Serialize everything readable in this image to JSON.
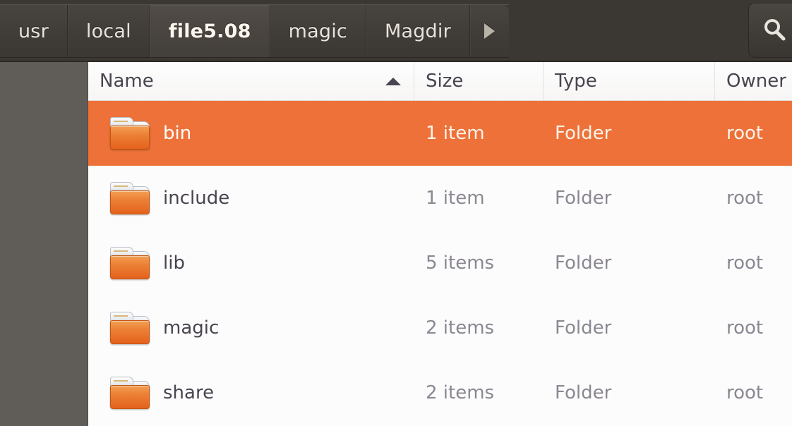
{
  "window": {
    "title": "file5.08",
    "accent_color": "#ed7138",
    "toolbar_bg": "#3b3834",
    "sidebar_bg": "#605c57"
  },
  "pathbar": {
    "crumbs": [
      {
        "label": "usr",
        "active": false
      },
      {
        "label": "local",
        "active": false
      },
      {
        "label": "file5.08",
        "active": true
      },
      {
        "label": "magic",
        "active": false
      },
      {
        "label": "Magdir",
        "active": false
      }
    ],
    "overflow_icon": "chevron-right-icon"
  },
  "toolbar": {
    "search_icon": "search-icon"
  },
  "file_list": {
    "columns": [
      {
        "label": "Name",
        "sorted": true,
        "sort_icon": "sort-ascending-icon"
      },
      {
        "label": "Size",
        "sorted": false,
        "sort_icon": ""
      },
      {
        "label": "Type",
        "sorted": false,
        "sort_icon": ""
      },
      {
        "label": "Owner",
        "sorted": false,
        "sort_icon": ""
      }
    ],
    "rows": [
      {
        "icon": "folder-icon",
        "name": "bin",
        "size": "1 item",
        "type": "Folder",
        "owner": "root",
        "selected": true
      },
      {
        "icon": "folder-icon",
        "name": "include",
        "size": "1 item",
        "type": "Folder",
        "owner": "root",
        "selected": false
      },
      {
        "icon": "folder-icon",
        "name": "lib",
        "size": "5 items",
        "type": "Folder",
        "owner": "root",
        "selected": false
      },
      {
        "icon": "folder-icon",
        "name": "magic",
        "size": "2 items",
        "type": "Folder",
        "owner": "root",
        "selected": false
      },
      {
        "icon": "folder-icon",
        "name": "share",
        "size": "2 items",
        "type": "Folder",
        "owner": "root",
        "selected": false
      }
    ]
  }
}
